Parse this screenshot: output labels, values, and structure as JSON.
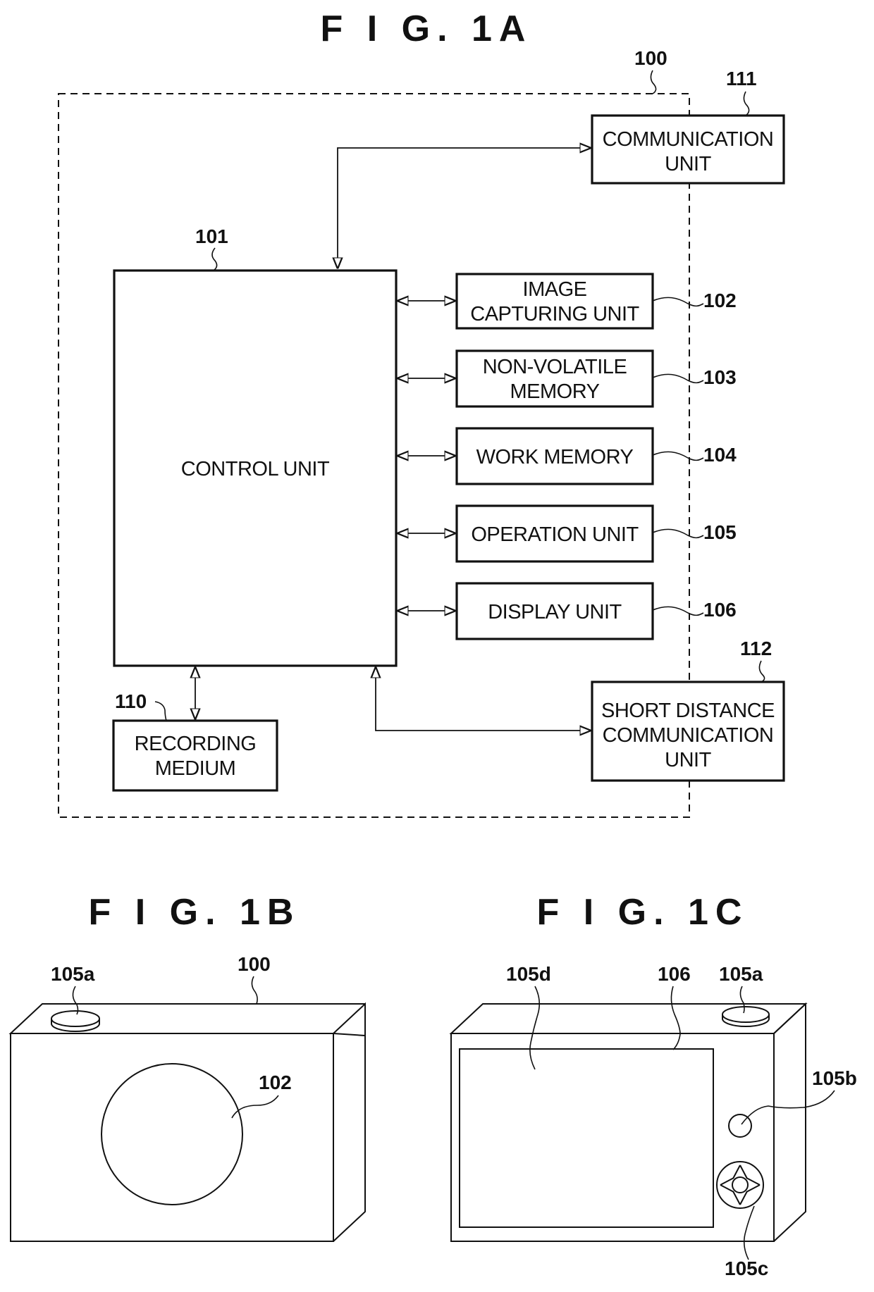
{
  "figures": {
    "fig1a": {
      "title": "F I G. 1A",
      "device_ref": "100",
      "blocks": {
        "control": {
          "ref": "101",
          "label": "CONTROL UNIT"
        },
        "image_capturing": {
          "ref": "102",
          "line1": "IMAGE",
          "line2": "CAPTURING UNIT"
        },
        "non_volatile": {
          "ref": "103",
          "line1": "NON-VOLATILE",
          "line2": "MEMORY"
        },
        "work_memory": {
          "ref": "104",
          "label": "WORK MEMORY"
        },
        "operation": {
          "ref": "105",
          "label": "OPERATION UNIT"
        },
        "display": {
          "ref": "106",
          "label": "DISPLAY UNIT"
        },
        "recording": {
          "ref": "110",
          "line1": "RECORDING",
          "line2": "MEDIUM"
        },
        "communication": {
          "ref": "111",
          "line1": "COMMUNICATION",
          "line2": "UNIT"
        },
        "short_distance": {
          "ref": "112",
          "line1": "SHORT DISTANCE",
          "line2": "COMMUNICATION",
          "line3": "UNIT"
        }
      }
    },
    "fig1b": {
      "title": "F I G. 1B",
      "refs": {
        "shutter": "105a",
        "body": "100",
        "lens": "102"
      }
    },
    "fig1c": {
      "title": "F I G. 1C",
      "refs": {
        "touch_panel": "105d",
        "display": "106",
        "shutter": "105a",
        "button": "105b",
        "dpad": "105c"
      }
    }
  }
}
